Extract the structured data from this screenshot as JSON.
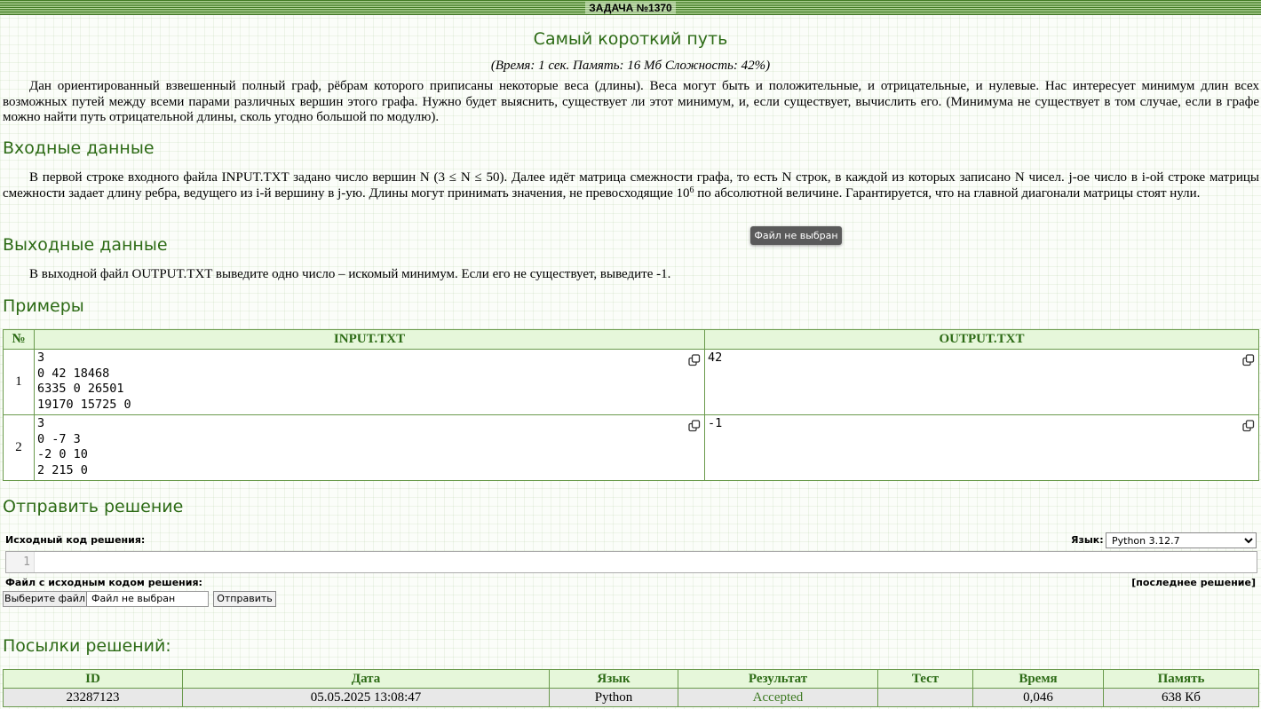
{
  "header": {
    "title": "ЗАДАЧА №1370"
  },
  "problem": {
    "title": "Самый короткий путь",
    "limits": "(Время: 1 сек. Память: 16 Мб Сложность: 42%)",
    "statement": "Дан ориентированный взвешенный полный граф, рёбрам которого приписаны некоторые веса (длины). Веса могут быть и положительные, и отрицательные, и нулевые. Нас интересует минимум длин всех возможных путей между всеми парами различных вершин этого графа. Нужно будет выяснить, существует ли этот минимум, и, если существует, вычислить его. (Минимума не существует в том случае, если в графе можно найти путь отрицательной длины, сколь угодно большой по модулю).",
    "input_heading": "Входные данные",
    "input_text_1": "В первой строке входного файла INPUT.TXT задано число вершин N (3 ≤ N ≤ 50). Далее идёт матрица смежности графа, то есть N строк, в каждой из которых записано N чисел. j-ое число в i-ой строке матрицы смежности задает длину ребра, ведущего из i-й вершину в j-ую. Длины могут принимать значения, не превосходящие 10",
    "input_text_exp": "6",
    "input_text_2": " по абсолютной величине. Гарантируется, что на главной диагонали матрицы стоят нули.",
    "output_heading": "Выходные данные",
    "output_text": "В выходной файл OUTPUT.TXT выведите одно число – искомый минимум. Если его не существует, выведите -1.",
    "examples_heading": "Примеры"
  },
  "tooltip": "Файл не выбран",
  "samples": {
    "headers": [
      "№",
      "INPUT.TXT",
      "OUTPUT.TXT"
    ],
    "rows": [
      {
        "num": "1",
        "input": "3\n0 42 18468\n6335 0 26501\n19170 15725 0",
        "output": "42"
      },
      {
        "num": "2",
        "input": "3\n0 -7 3\n-2 0 10\n2 215 0",
        "output": "-1"
      }
    ]
  },
  "submit": {
    "heading": "Отправить решение",
    "source_label": "Исходный код решения:",
    "lang_label": "Язык:",
    "lang_value": "Python 3.12.7",
    "line_number": "1",
    "file_label": "Файл с исходным кодом решения:",
    "last_solution": "[последнее решение]",
    "choose_file": "Выберите файл",
    "file_status": "Файл не выбран",
    "send": "Отправить"
  },
  "submissions": {
    "heading": "Посылки решений:",
    "headers": [
      "ID",
      "Дата",
      "Язык",
      "Результат",
      "Тест",
      "Время",
      "Память"
    ],
    "rows": [
      {
        "id": "23287123",
        "date": "05.05.2025 13:08:47",
        "lang": "Python",
        "result": "Accepted",
        "test": "",
        "time": "0,046",
        "memory": "638 Кб"
      }
    ]
  },
  "colors": {
    "accent": "#2d6b16",
    "header_bg": "#e6f7da",
    "border": "#6a9a4c"
  },
  "icons": {
    "copy": "copy-icon"
  }
}
